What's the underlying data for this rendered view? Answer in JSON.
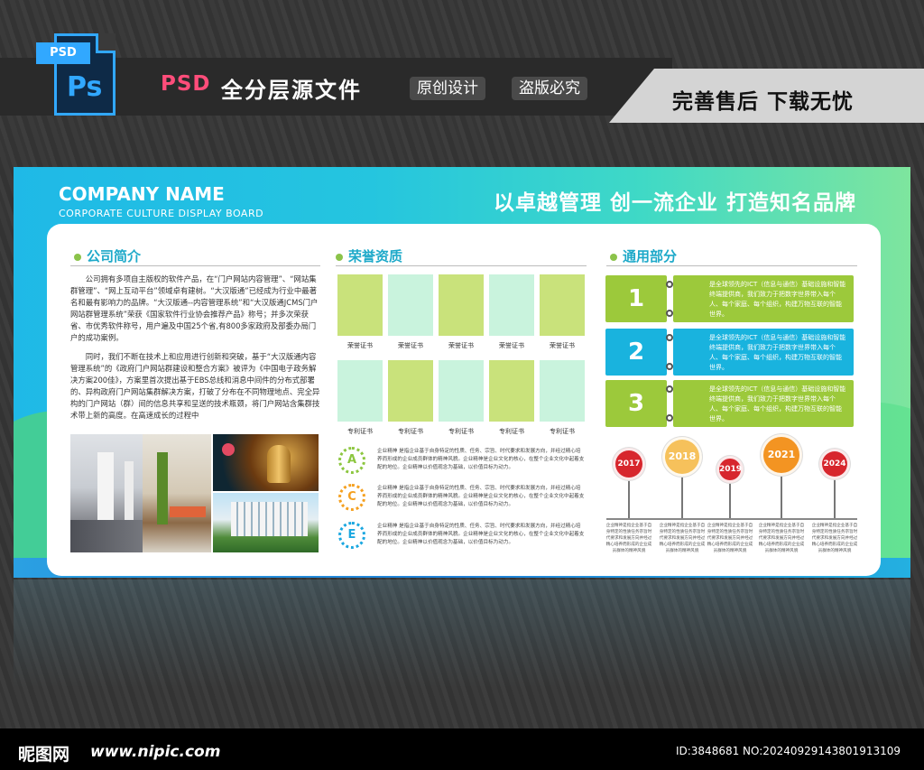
{
  "header": {
    "ps_badge": "PSD",
    "ps_letters": "Ps",
    "psd_label": "PSD",
    "title": "全分层源文件",
    "tag1": "原创设计",
    "tag2": "盗版必究",
    "right_text": "完善售后 下载无忧"
  },
  "board": {
    "company_name": "COMPANY NAME",
    "company_sub": "CORPORATE CULTURE DISPLAY BOARD",
    "slogan": "以卓越管理 创一流企业 打造知名品牌"
  },
  "intro": {
    "heading": "公司简介",
    "p1": "公司拥有多项自主版权的软件产品，在“门户网站内容管理”、“网站集群管理”、“网上互动平台”领域卓有建树。“大汉版通”已经成为行业中最著名和最有影响力的品牌。“大汉版通--内容管理系统”和“大汉版通JCMS门户网站群管理系统”荣获《国家软件行业协会推荐产品》称号；并多次荣获省、市优秀软件称号，用户遍及中国25个省,有800多家政府及部委办局门户的成功案例。",
    "p2": "同时，我们不断在技术上和应用进行创新和突破，基于“大汉版通内容管理系统”的《政府门户网站群建设和整合方案》被评为《中国电子政务解决方案200佳》，方案里首次提出基于EBS总线和消息中间件的分布式部署的、异构政府门户网站集群解决方案，打破了分布在不同物理地点、完全异构的门户网站（群）间的信息共享和呈送的技术瓶颈，将门户网站含集群技术带上新的高度。在高速成长的过程中"
  },
  "honor": {
    "heading": "荣誉资质",
    "row1_label": "荣誉证书",
    "row2_label": "专利证书",
    "row1_colors": [
      "#c9e27b",
      "#c9f3dd",
      "#c9e27b",
      "#c9f3dd",
      "#c9e27b"
    ],
    "row2_colors": [
      "#c9f3dd",
      "#c9e27b",
      "#c9f3dd",
      "#c9e27b",
      "#c9f3dd"
    ],
    "abc": [
      {
        "letter": "A",
        "color": "#8cc63f",
        "text": "企业精神 是指企业基于自身特定的性质、任务、宗旨、时代要求和发展方向，并经过精心培养而形成的企业成员群体的精神风貌。企业精神是企业文化的核心，在整个企业文化中起着支配的地位。企业精神以价值观念为基础，以价值目标为动力。"
      },
      {
        "letter": "C",
        "color": "#f5a01f",
        "text": "企业精神 是指企业基于自身特定的性质、任务、宗旨、时代要求和发展方向，并经过精心培养而形成的企业成员群体的精神风貌。企业精神是企业文化的核心，在整个企业文化中起着支配的地位。企业精神以价值观念为基础，以价值目标为动力。"
      },
      {
        "letter": "E",
        "color": "#1aa7e0",
        "text": "企业精神 是指企业基于自身特定的性质、任务、宗旨、时代要求和发展方向，并经过精心培养而形成的企业成员群体的精神风貌。企业精神是企业文化的核心，在整个企业文化中起着支配的地位。企业精神以价值观念为基础，以价值目标为动力。"
      }
    ]
  },
  "general": {
    "heading": "通用部分",
    "items": [
      {
        "num": "1",
        "color": "#9cc93b",
        "text": "是全球领先的ICT（信息与通信）基础设施和智能终端提供商，我们致力于把数字世界带入每个人、每个家庭、每个组织，构建万物互联的智能世界。"
      },
      {
        "num": "2",
        "color": "#19b3de",
        "text": "是全球领先的ICT（信息与通信）基础设施和智能终端提供商，我们致力于把数字世界带入每个人、每个家庭、每个组织，构建万物互联的智能世界。"
      },
      {
        "num": "3",
        "color": "#9cc93b",
        "text": "是全球领先的ICT（信息与通信）基础设施和智能终端提供商，我们致力于把数字世界带入每个人、每个家庭、每个组织，构建万物互联的智能世界。"
      }
    ],
    "timeline": [
      {
        "year": "2017",
        "color": "#d7262d"
      },
      {
        "year": "2018",
        "color": "#f6c15b"
      },
      {
        "year": "2019",
        "color": "#d7262d"
      },
      {
        "year": "2021",
        "color": "#f39422"
      },
      {
        "year": "2024",
        "color": "#d7262d"
      }
    ],
    "timeline_text": "企业精神是指企业基于自身特定的性质任务宗旨时代要求和发展方向并经过精心培养而形成的企业成员群体的精神风貌"
  },
  "footer": {
    "logo": "昵图网",
    "url": "www.nipic.com",
    "id": "ID:3848681 NO:20240929143801913109"
  }
}
